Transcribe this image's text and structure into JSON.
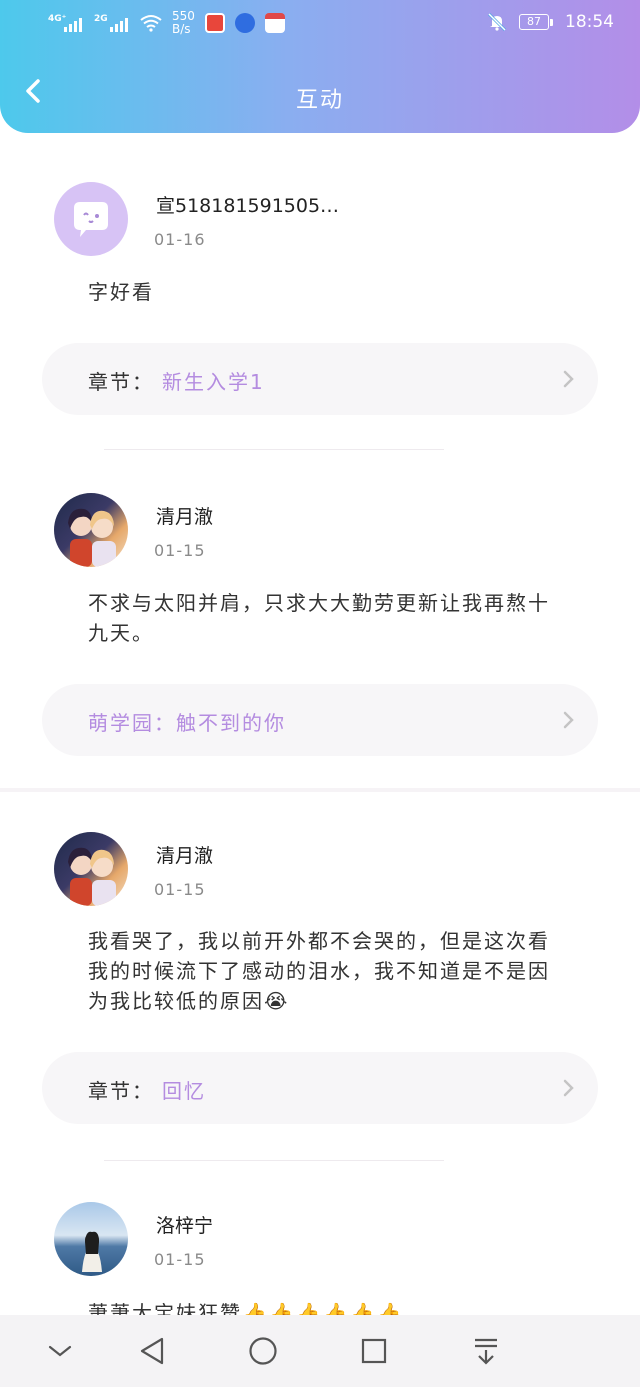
{
  "status_bar": {
    "signal1_label": "4G⁺",
    "signal2_label": "2G",
    "net_speed_value": "550",
    "net_speed_unit": "B/s",
    "battery": "87",
    "time": "18:54"
  },
  "header": {
    "title": "互动",
    "back_icon": "chevron-left-icon"
  },
  "comments": [
    {
      "username": "宣518181591505…",
      "date": "01-16",
      "text": "字好看",
      "chapter_label": "章节：",
      "chapter_value": "新生入学1"
    },
    {
      "username": "清月澈",
      "date": "01-15",
      "text": "不求与太阳并肩，只求大大勤劳更新让我再熬十九天。",
      "chapter_label": "",
      "chapter_value": "萌学园：触不到的你"
    },
    {
      "username": "清月澈",
      "date": "01-15",
      "text": "我看哭了，我以前开外都不会哭的，但是这次看我的时候流下了感动的泪水，我不知道是不是因为我比较低的原因😭",
      "chapter_label": "章节：",
      "chapter_value": "回忆"
    },
    {
      "username": "洛梓宁",
      "date": "01-15",
      "text": "萧萧大宝妹狂赞👍👍👍👍👍👍"
    }
  ],
  "colors": {
    "header_gradient_start": "#4dc9ec",
    "header_gradient_end": "#b38ee8",
    "accent_purple": "#b48ce0"
  },
  "nav_icons": [
    "chevron-down-icon",
    "back-triangle-icon",
    "home-circle-icon",
    "recents-square-icon",
    "notification-pull-icon"
  ]
}
